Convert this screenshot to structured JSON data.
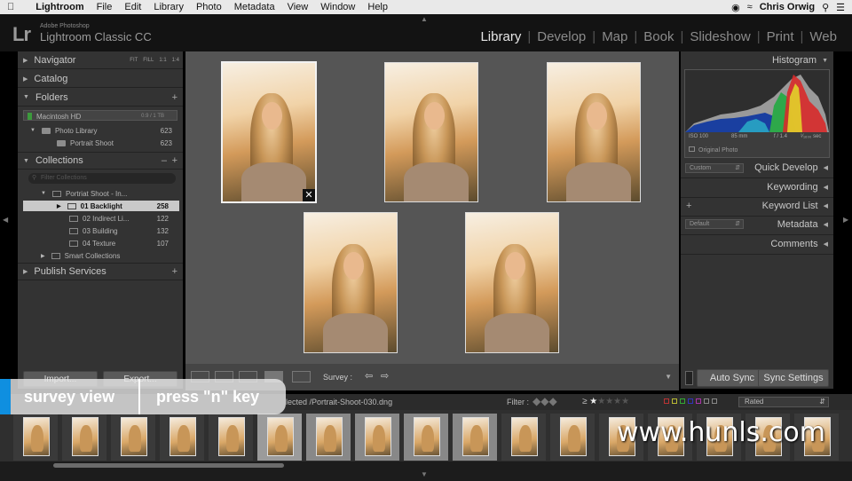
{
  "menubar": {
    "app": "Lightroom",
    "items": [
      "File",
      "Edit",
      "Library",
      "Photo",
      "Metadata",
      "View",
      "Window",
      "Help"
    ],
    "user": "Chris Orwig"
  },
  "header": {
    "brand_small": "Adobe Photoshop",
    "brand": "Lightroom Classic CC",
    "modules": [
      "Library",
      "Develop",
      "Map",
      "Book",
      "Slideshow",
      "Print",
      "Web"
    ],
    "active_module": "Library"
  },
  "left": {
    "navigator": "Navigator",
    "nav_modes": [
      "FIT",
      "FILL",
      "1:1",
      "1:4"
    ],
    "catalog": "Catalog",
    "folders": "Folders",
    "volume": "Macintosh HD",
    "volume_size": "0.9 / 1 TB",
    "folder_items": [
      {
        "label": "Photo Library",
        "count": "623"
      },
      {
        "label": "Portrait Shoot",
        "count": "623"
      }
    ],
    "collections": "Collections",
    "search_placeholder": "Filter Collections",
    "collection_set": "Portriat Shoot - In...",
    "collection_items": [
      {
        "label": "01 Backlight",
        "count": "258"
      },
      {
        "label": "02 Indirect Li...",
        "count": "122"
      },
      {
        "label": "03 Building",
        "count": "132"
      },
      {
        "label": "04 Texture",
        "count": "107"
      }
    ],
    "smart": "Smart Collections",
    "publish": "Publish Services",
    "import_btn": "Import...",
    "export_btn": "Export..."
  },
  "toolbar": {
    "survey": "Survey :"
  },
  "right": {
    "histogram": "Histogram",
    "iso": "ISO 100",
    "focal": "85 mm",
    "fstop": "f / 1.4",
    "shutter": "¹⁄₁₆₀₀ sec",
    "original": "Original Photo",
    "quick_develop": "Quick Develop",
    "custom": "Custom",
    "keywording": "Keywording",
    "keyword_list": "Keyword List",
    "metadata": "Metadata",
    "default": "Default",
    "comments": "Comments",
    "auto_sync": "Auto Sync",
    "sync_settings": "Sync Settings"
  },
  "filmbar": {
    "path": "lected /Portrait-Shoot-030.dng",
    "filter": "Filter :",
    "rated": "Rated"
  },
  "overlay": {
    "left": "survey view",
    "right": "press \"n\" key"
  },
  "watermark": "www.hunls.com",
  "colors": {
    "accent_blue": "#0f8fe0",
    "panel": "#333333",
    "active_module": "#e6e6e6"
  }
}
